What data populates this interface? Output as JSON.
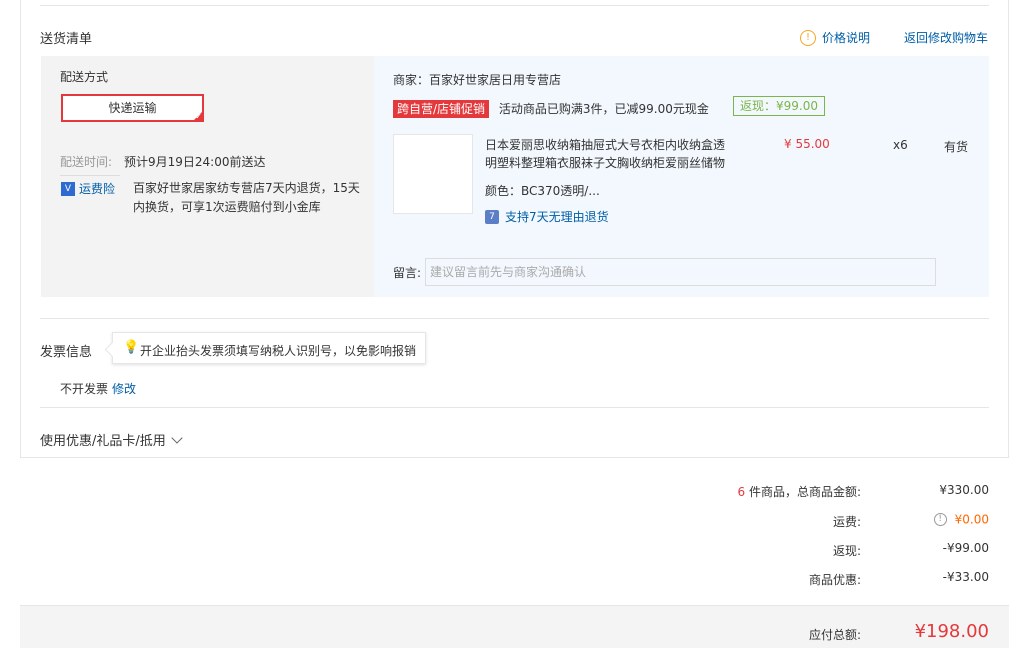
{
  "delivery": {
    "title": "送货清单",
    "price_info_link": "价格说明",
    "back_to_cart": "返回修改购物车",
    "shipping_label": "配送方式",
    "shipping_method": "快递运输",
    "ship_time_label": "配送时间:",
    "ship_time_value": "预计9月19日24:00前送达",
    "insurance_label": "运费险",
    "insurance_line1": "百家好世家居家纺专营店7天内退货，15天",
    "insurance_line2": "内换货，可享1次运费赔付到小金库"
  },
  "store": {
    "name": "商家：百家好世家居日用专营店",
    "promo_tag": "跨自营/店铺促销",
    "promo_text": "活动商品已购满3件，已减99.00元现金",
    "rebate": "返现：¥99.00"
  },
  "product": {
    "title_line1": "日本爱丽思收纳箱抽屉式大号衣柜内收纳盒透",
    "title_line2": "明塑料整理箱衣服袜子文胸收纳柜爱丽丝储物",
    "color": "颜色：BC370透明/...",
    "return_policy": "支持7天无理由退货",
    "price": "¥ 55.00",
    "qty": "x6",
    "stock": "有货"
  },
  "message": {
    "label": "留言:",
    "placeholder": "建议留言前先与商家沟通确认"
  },
  "invoice": {
    "title": "发票信息",
    "tip": "开企业抬头发票须填写纳税人识别号，以免影响报销",
    "status": "不开发票",
    "edit": "修改"
  },
  "coupon": {
    "title": "使用优惠/礼品卡/抵用"
  },
  "summary": {
    "count": "6",
    "goods_label": "件商品，总商品金额:",
    "goods_amount": "¥330.00",
    "freight_label": "运费:",
    "freight_amount": "¥0.00",
    "rebate_label": "返现:",
    "rebate_amount": "-¥99.00",
    "discount_label": "商品优惠:",
    "discount_amount": "-¥33.00",
    "total_label": "应付总额:",
    "total_amount": "¥198.00"
  }
}
